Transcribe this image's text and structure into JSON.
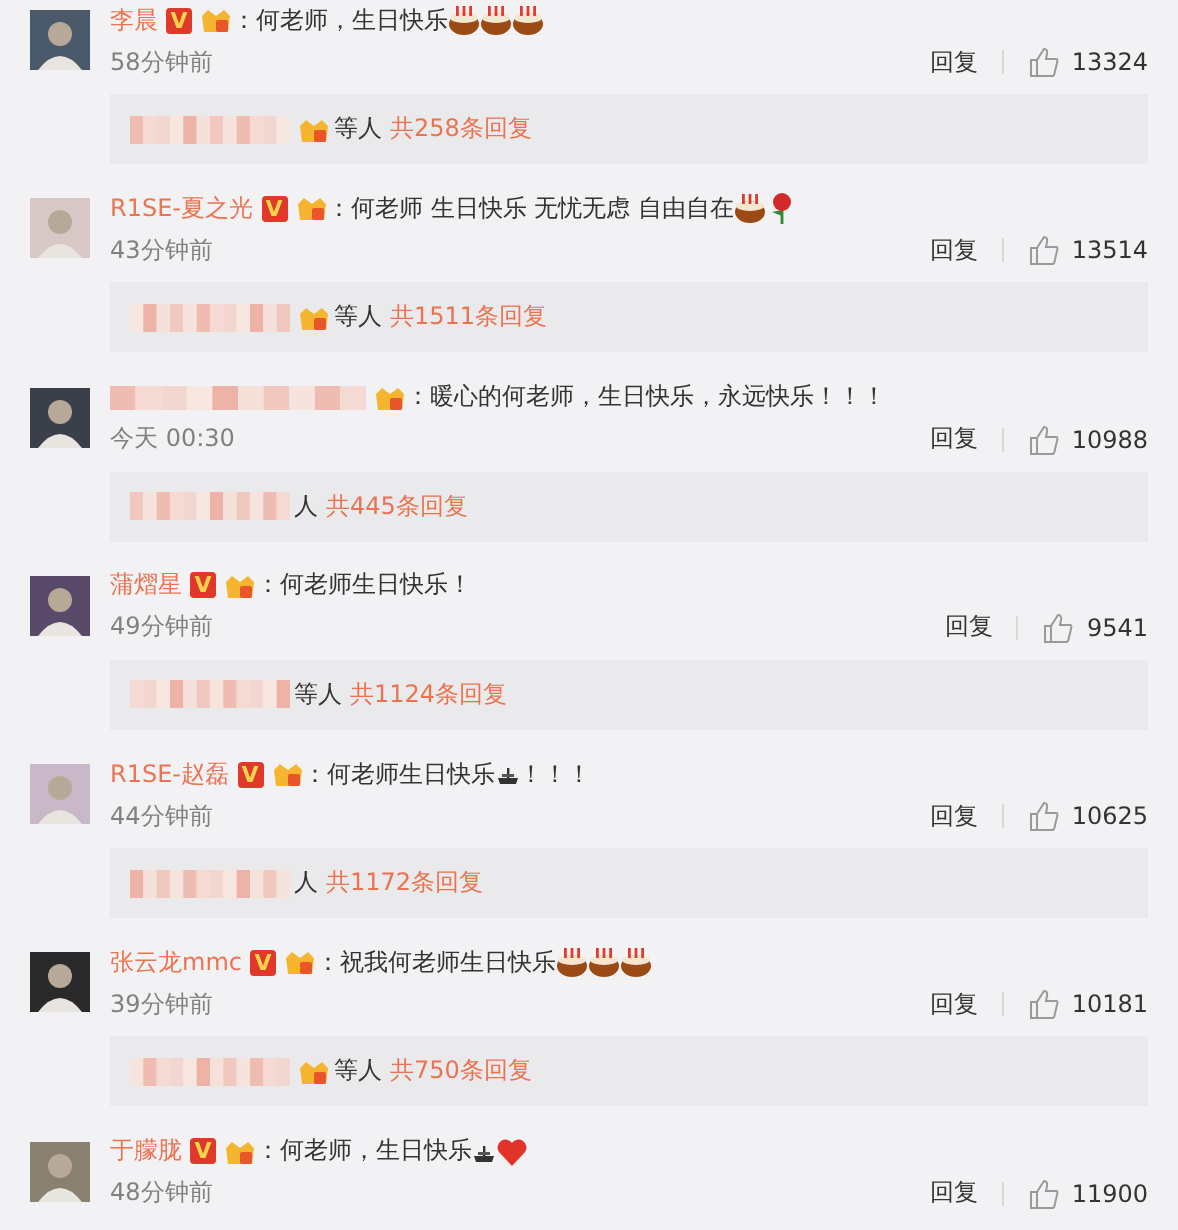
{
  "comments": [
    {
      "author": "李晨",
      "badge": "V",
      "text": "：何老师，生日快乐",
      "emojis": [
        {
          "kind": "cake"
        },
        {
          "kind": "cake"
        },
        {
          "kind": "cake"
        }
      ],
      "time": "58分钟前",
      "reply": "回复",
      "likes": "13324",
      "thread": {
        "crown": true,
        "suffix": "等人",
        "count": "共258条回复"
      }
    },
    {
      "author": "R1SE-夏之光",
      "badge": "V",
      "text": "：何老师 生日快乐 无忧无虑 自由自在",
      "emojis": [
        {
          "kind": "cake"
        },
        {
          "kind": "rose"
        }
      ],
      "time": "43分钟前",
      "reply": "回复",
      "likes": "13514",
      "thread": {
        "crown": true,
        "suffix": "等人",
        "count": "共1511条回复"
      }
    },
    {
      "text": "：暖心的何老师，生日快乐，永远快乐！！！",
      "time": "今天 00:30",
      "reply": "回复",
      "likes": "10988",
      "thread": {
        "crown": false,
        "suffix": "人",
        "count": "共445条回复"
      }
    },
    {
      "author": "蒲熠星",
      "badge": "V",
      "text": "：何老师生日快乐！",
      "time": "49分钟前",
      "reply": "回复",
      "likes": "9541",
      "thread": {
        "crown": false,
        "suffix": "等人",
        "count": "共1124条回复"
      }
    },
    {
      "author": "R1SE-赵磊",
      "badge": "V",
      "text": "：何老师生日快乐",
      "emojis": [
        {
          "kind": "ship"
        }
      ],
      "tail": "！！！",
      "time": "44分钟前",
      "reply": "回复",
      "likes": "10625",
      "thread": {
        "crown": false,
        "suffix": "人",
        "count": "共1172条回复"
      }
    },
    {
      "author": "张云龙mmc",
      "badge": "V",
      "text": "：祝我何老师生日快乐",
      "emojis": [
        {
          "kind": "cake"
        },
        {
          "kind": "cake"
        },
        {
          "kind": "cake"
        }
      ],
      "time": "39分钟前",
      "reply": "回复",
      "likes": "10181",
      "thread": {
        "crown": true,
        "suffix": "等人",
        "count": "共750条回复"
      }
    },
    {
      "author": "于朦胧",
      "badge": "V",
      "text": "：何老师，生日快乐",
      "emojis": [
        {
          "kind": "ship"
        },
        {
          "kind": "heart"
        }
      ],
      "time": "48分钟前",
      "reply": "回复",
      "likes": "11900"
    }
  ]
}
